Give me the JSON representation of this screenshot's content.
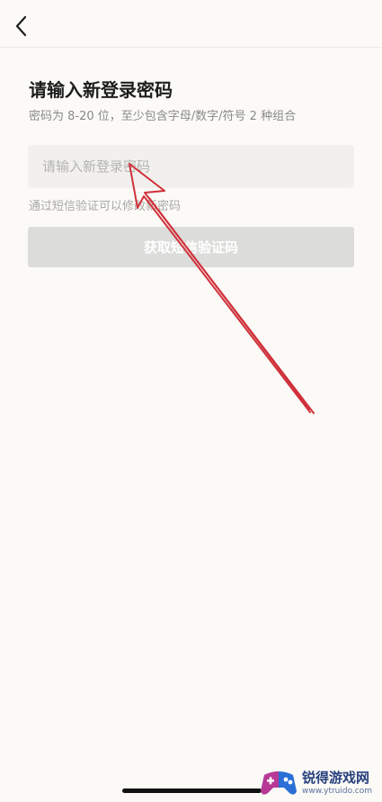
{
  "header": {
    "back_icon": "chevron-left-icon"
  },
  "main": {
    "title": "请输入新登录密码",
    "hint": "密码为 8-20 位，至少包含字母/数字/符号 2 种组合",
    "password_placeholder": "请输入新登录密码",
    "password_value": "",
    "sms_hint": "通过短信验证可以修改新密码",
    "get_code_label": "获取短信验证码"
  },
  "annotation": {
    "arrow_icon": "red-arrow-annotation",
    "color": "#d0303a"
  },
  "watermark": {
    "brand": "锐得游戏网",
    "url": "www.ytruido.com"
  },
  "colors": {
    "background": "#fbfaf6",
    "input_bg": "#f1f0ec",
    "button_disabled": "#dcdcda"
  }
}
